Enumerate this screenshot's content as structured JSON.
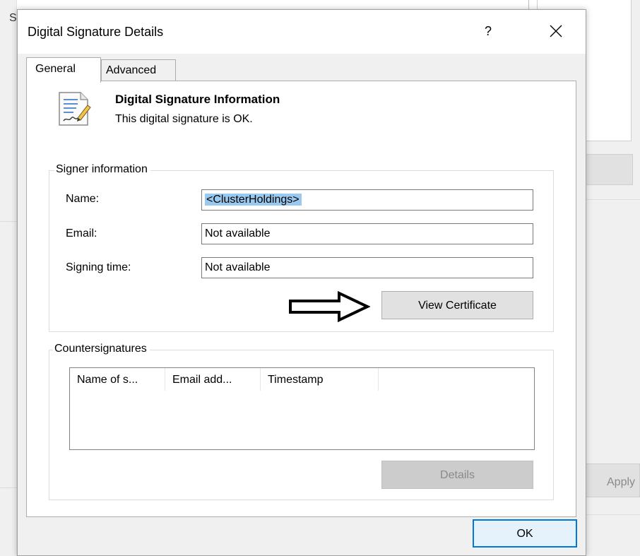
{
  "background_window": {
    "left_text": "S",
    "apply_label": "Apply"
  },
  "dialog": {
    "title": "Digital Signature Details",
    "help_label": "?",
    "close_icon": "close-icon"
  },
  "tabs": [
    {
      "label": "General",
      "selected": true
    },
    {
      "label": "Advanced",
      "selected": false
    }
  ],
  "info": {
    "icon": "signed-document-icon",
    "title": "Digital Signature Information",
    "status": "This digital signature is OK."
  },
  "signer": {
    "legend": "Signer information",
    "name_label": "Name:",
    "name_value": "<ClusterHoldings>",
    "email_label": "Email:",
    "email_value": "Not available",
    "signing_time_label": "Signing time:",
    "signing_time_value": "Not available",
    "view_certificate_label": "View Certificate"
  },
  "annotation": {
    "arrow_icon": "right-arrow-icon"
  },
  "countersignatures": {
    "legend": "Countersignatures",
    "columns": [
      "Name of s...",
      "Email add...",
      "Timestamp"
    ],
    "details_label": "Details"
  },
  "footer": {
    "ok_label": "OK"
  },
  "colors": {
    "selection": "#99c9ef",
    "ok_border": "#0078d7",
    "dialog_bg": "#f0f0f0"
  }
}
